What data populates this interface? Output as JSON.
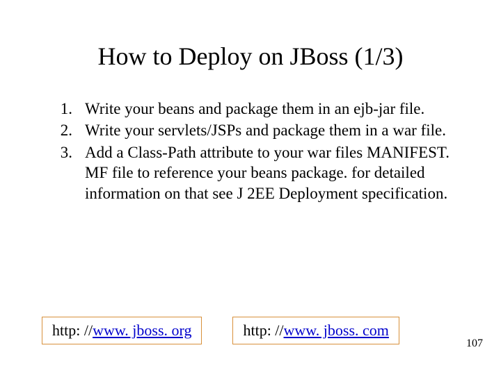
{
  "title": "How to Deploy on JBoss (1/3)",
  "items": [
    {
      "num": "1.",
      "text": "Write your beans and package them in an ejb-jar file."
    },
    {
      "num": "2.",
      "text": "Write your servlets/JSPs and package them in a war file."
    },
    {
      "num": "3.",
      "text": "Add a Class-Path attribute to your war files MANIFEST. MF file to reference your beans package. for detailed information on that see J 2EE Deployment specification."
    }
  ],
  "links": [
    {
      "prefix": "http: //",
      "url": "www. jboss. org"
    },
    {
      "prefix": "http: //",
      "url": "www. jboss. com"
    }
  ],
  "page_number": "107"
}
